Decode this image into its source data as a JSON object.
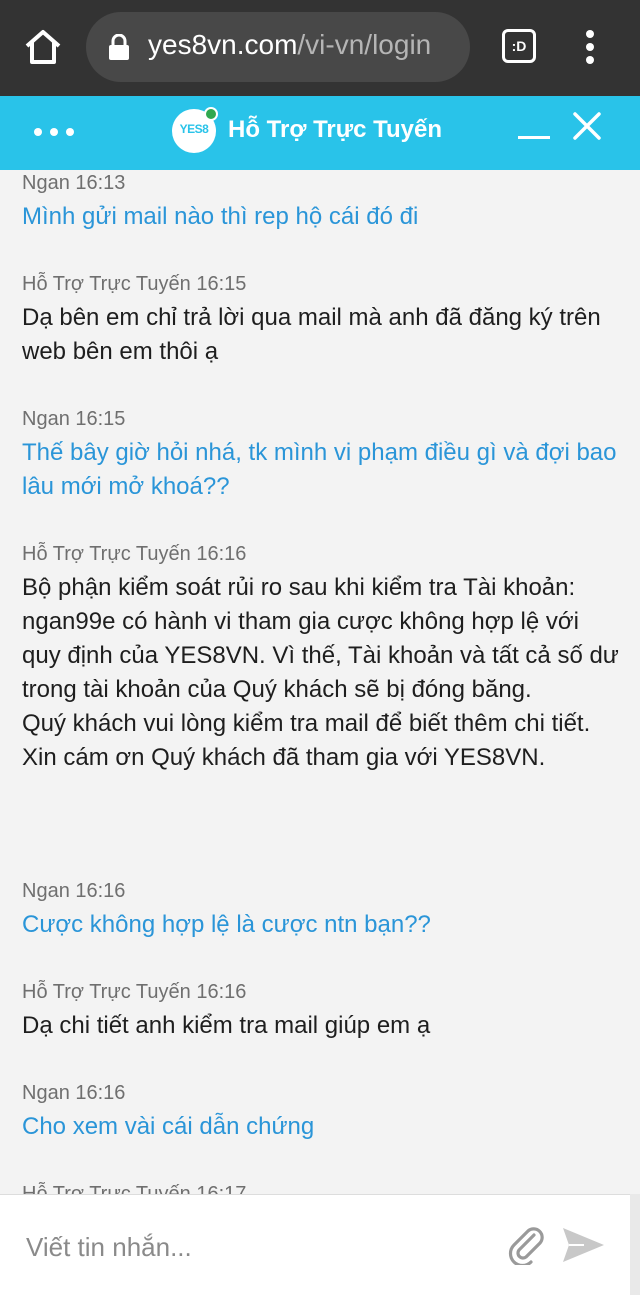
{
  "browser": {
    "url_host": "yes8vn.com",
    "url_path": "/vi-vn/login",
    "tabs_label": ":D"
  },
  "chat": {
    "header_title": "Hỗ Trợ Trực Tuyến",
    "logo_text": "YES8",
    "accent_color": "#29c3e9",
    "user_text_color": "#2a95d8",
    "messages": [
      {
        "sender": "Ngan",
        "time": "16:13",
        "text": "Mình gửi mail nào thì rep hộ cái đó đi"
      },
      {
        "sender": "Hỗ Trợ Trực Tuyến",
        "time": "16:15",
        "text": "Dạ bên em chỉ trả lời qua mail mà anh đã đăng ký trên web bên em thôi ạ"
      },
      {
        "sender": "Ngan",
        "time": "16:15",
        "text": "Thế bây giờ hỏi nhá, tk mình vi phạm điều gì và đợi bao lâu mới mở khoá??"
      },
      {
        "sender": "Hỗ Trợ Trực Tuyến",
        "time": "16:16",
        "text": "Bộ phận kiểm soát rủi ro sau khi kiểm tra Tài khoản: ngan99e có hành vi tham gia cược không hợp lệ với quy định của YES8VN. Vì thế, Tài khoản và tất cả số dư trong tài khoản của Quý khách sẽ bị đóng băng.\nQuý khách vui lòng kiểm tra mail để biết thêm chi tiết. Xin cám ơn Quý khách đã tham gia với YES8VN."
      },
      {
        "sender": "Ngan",
        "time": "16:16",
        "text": "Cược không hợp lệ là cược ntn bạn??"
      },
      {
        "sender": "Hỗ Trợ Trực Tuyến",
        "time": "16:16",
        "text": "Dạ chi tiết anh kiểm tra mail giúp em ạ"
      },
      {
        "sender": "Ngan",
        "time": "16:16",
        "text": "Cho xem vài cái dẫn chứng"
      },
      {
        "sender": "Hỗ Trợ Trực Tuyến",
        "time": "16:17",
        "text": ""
      }
    ]
  },
  "composer": {
    "placeholder": "Viết tin nhắn..."
  }
}
